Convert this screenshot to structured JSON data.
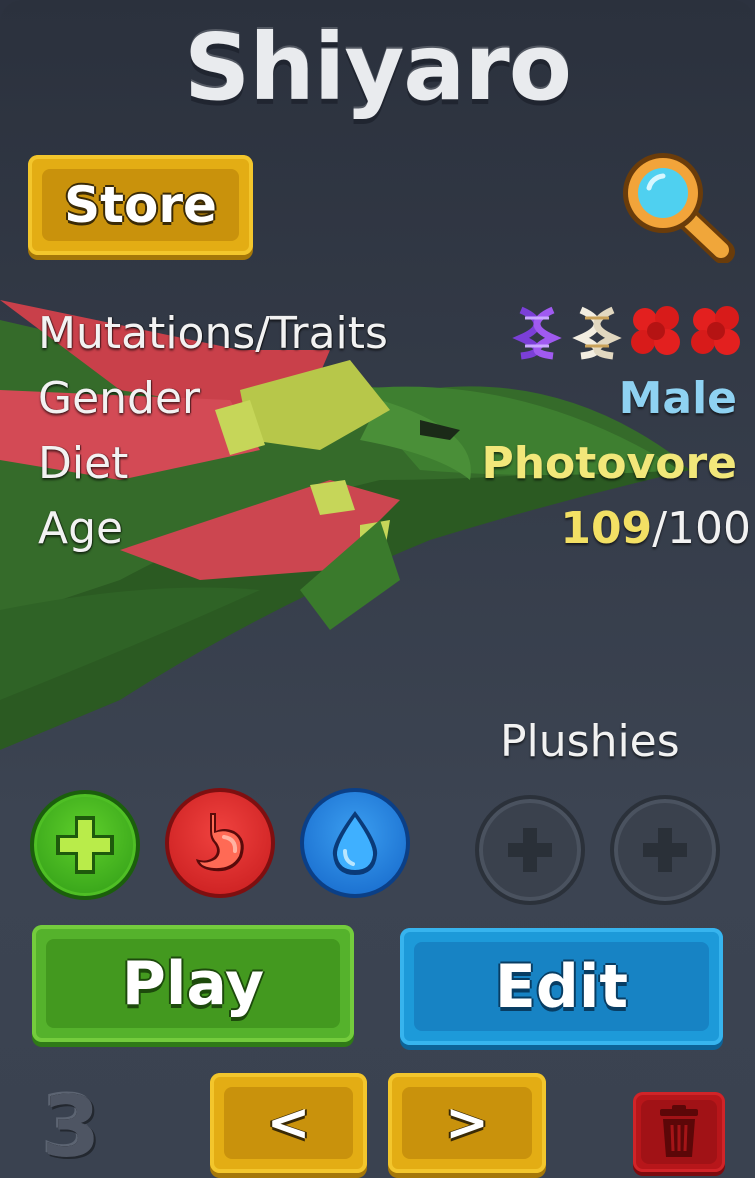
{
  "title": "Shiyaro",
  "buttons": {
    "store": "Store",
    "play": "Play",
    "edit": "Edit",
    "prev": "<",
    "next": ">"
  },
  "stats": {
    "traits_label": "Mutations/Traits",
    "gender_label": "Gender",
    "gender_value": "Male",
    "diet_label": "Diet",
    "diet_value": "Photovore",
    "age_label": "Age",
    "age_current": "109",
    "age_separator": "/",
    "age_max": "100"
  },
  "trait_icons": [
    "purple-dna-icon",
    "white-dna-icon",
    "red-cells-icon",
    "red-cells-icon"
  ],
  "plushies_label": "Plushies",
  "slot_number": "3",
  "colors": {
    "gender_male": "#8fd2f2",
    "diet": "#f2e77a",
    "age_current": "#f3e064"
  }
}
